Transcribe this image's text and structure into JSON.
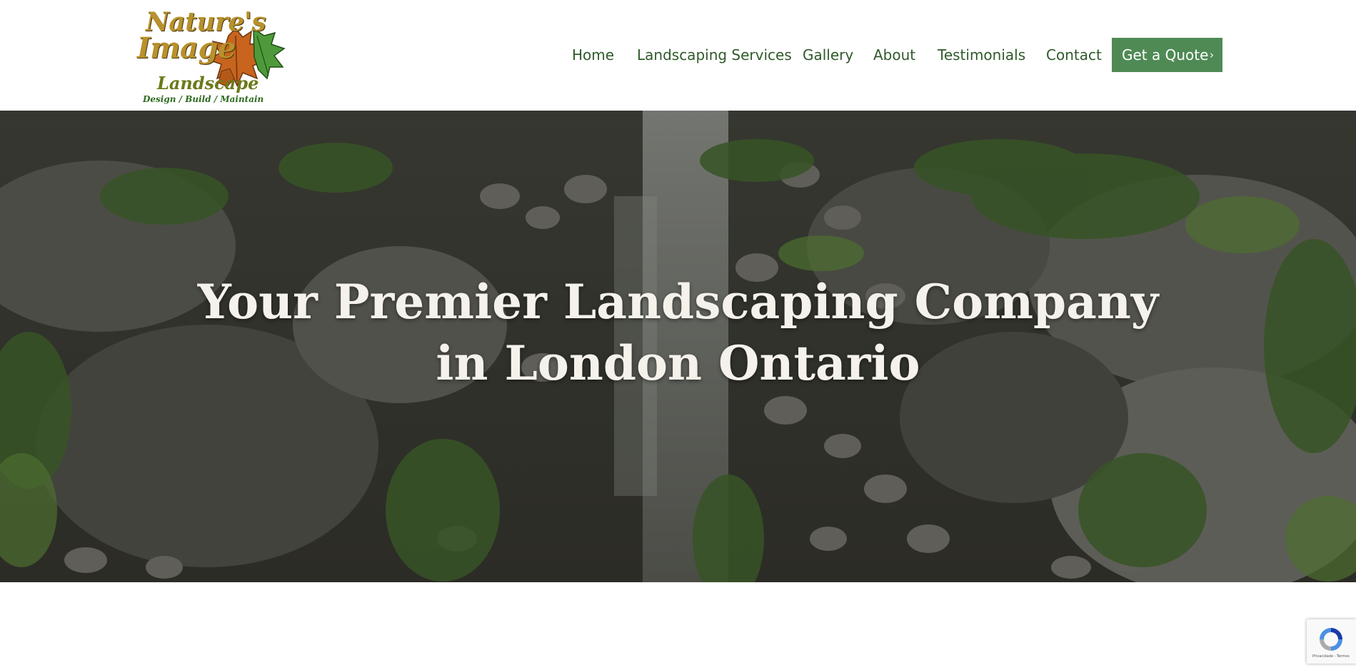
{
  "logo": {
    "line1": "Nature's",
    "line2": "Image",
    "line3": "Landscape",
    "tagline": "Design / Build / Maintain"
  },
  "nav": {
    "items": [
      {
        "label": "Home"
      },
      {
        "label": "Landscaping Services"
      },
      {
        "label": "Gallery"
      },
      {
        "label": "About"
      },
      {
        "label": "Testimonials"
      },
      {
        "label": "Contact"
      }
    ],
    "cta_label": "Get a Quote",
    "cta_icon": "chevron-right-icon"
  },
  "hero": {
    "title_line1": "Your Premier Landscaping Company",
    "title_line2": "in London Ontario",
    "background": "waterfall-rock-garden"
  },
  "recaptcha": {
    "terms": "Privacidade - Termos"
  },
  "colors": {
    "nav_text": "#2f5a2a",
    "cta_bg": "#4f8a55",
    "logo_gold": "#b8912c",
    "logo_green": "#2d6b1f",
    "hero_text": "#f4f2ea"
  }
}
